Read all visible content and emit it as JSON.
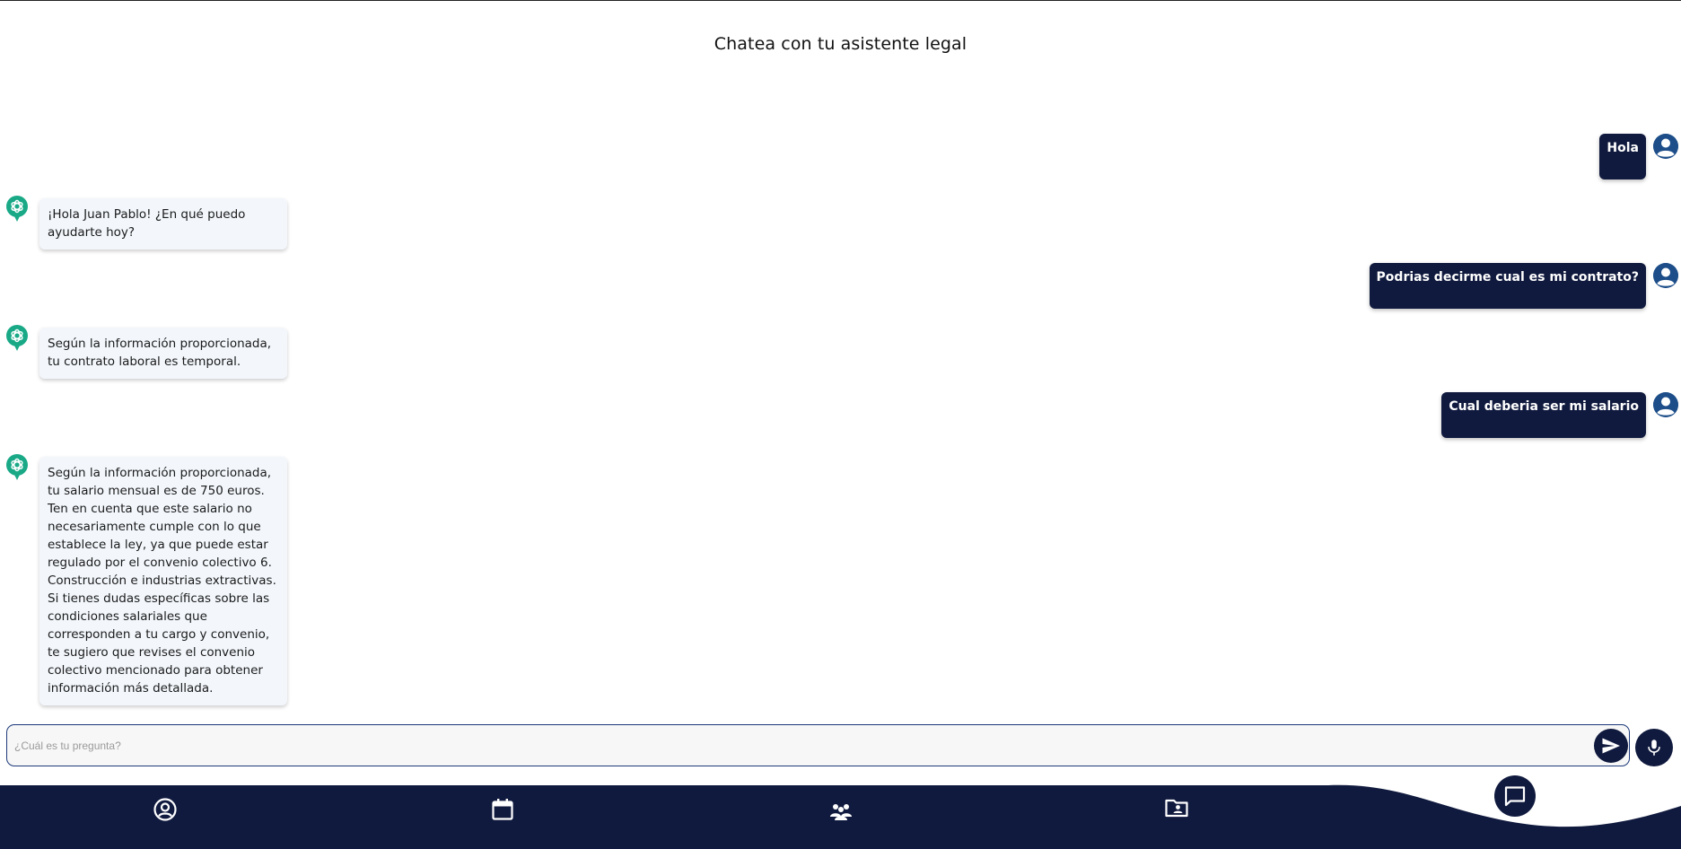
{
  "header": {
    "title": "Chatea con tu asistente legal"
  },
  "messages": [
    {
      "role": "user",
      "text": "Hola"
    },
    {
      "role": "assistant",
      "text": "¡Hola Juan Pablo! ¿En qué puedo ayudarte hoy?"
    },
    {
      "role": "user",
      "text": "Podrias decirme cual es mi contrato?"
    },
    {
      "role": "assistant",
      "text": "Según la información proporcionada, tu contrato laboral es temporal."
    },
    {
      "role": "user",
      "text": "Cual deberia ser mi salario"
    },
    {
      "role": "assistant",
      "text": "Según la información proporcionada, tu salario mensual es de 750 euros. Ten en cuenta que este salario no necesariamente cumple con lo que establece la ley, ya que puede estar regulado por el convenio colectivo 6. Construcción e industrias extractivas. Si tienes dudas específicas sobre las condiciones salariales que corresponden a tu cargo y convenio, te sugiero que revises el convenio colectivo mencionado para obtener información más detallada."
    }
  ],
  "composer": {
    "placeholder": "¿Cuál es tu pregunta?",
    "value": "",
    "send_icon": "send-icon",
    "mic_icon": "microphone-icon"
  },
  "bottom_nav": {
    "items": [
      {
        "icon": "profile-icon",
        "active": false
      },
      {
        "icon": "calendar-icon",
        "active": false
      },
      {
        "icon": "community-icon",
        "active": false
      },
      {
        "icon": "folder-user-icon",
        "active": false
      },
      {
        "icon": "chat-icon",
        "active": true
      }
    ]
  },
  "colors": {
    "navy": "#101a3e",
    "user_avatar": "#1d4e89",
    "bot_avatar": "#19a987",
    "bot_bubble": "#f3f7fc"
  }
}
